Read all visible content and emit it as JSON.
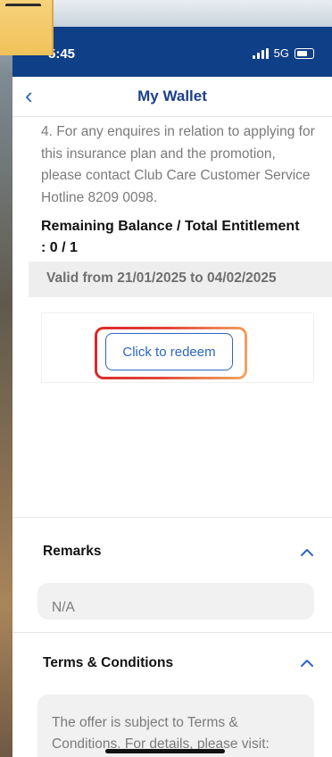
{
  "status_bar": {
    "time": "5:45",
    "network": "5G"
  },
  "nav": {
    "title": "My Wallet",
    "back_icon": "chevron-left-icon"
  },
  "content": {
    "paragraph": "4. For any enquires in relation to applying for this insurance plan and the promotion, please contact Club Care Customer Service Hotline 8209 0098.",
    "balance_label": "Remaining Balance / Total Entitlement",
    "balance_value": ": 0 / 1",
    "validity": "Valid from 21/01/2025 to 04/02/2025",
    "redeem_button": "Click to redeem"
  },
  "remarks": {
    "title": "Remarks",
    "value": "N/A"
  },
  "terms": {
    "title": "Terms & Conditions",
    "text": "The offer is subject to Terms & Conditions. For details, please visit:"
  },
  "colors": {
    "header_bg": "#0f3f86",
    "accent": "#2c66c4",
    "highlight_start": "#d9262a",
    "highlight_end": "#f0a564"
  }
}
